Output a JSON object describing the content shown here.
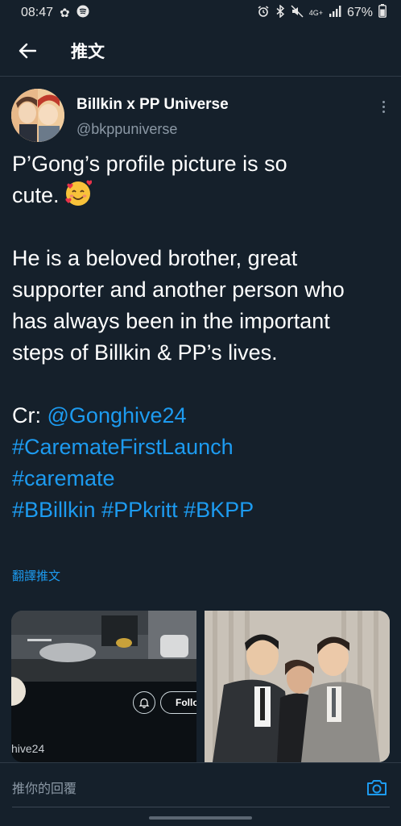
{
  "status_bar": {
    "time": "08:47",
    "network": "4G+",
    "battery": "67%"
  },
  "header": {
    "title": "推文"
  },
  "author": {
    "name": "Billkin x PP Universe",
    "handle": "@bkppuniverse"
  },
  "tweet": {
    "line1": "P’Gong’s profile picture is so",
    "line2": "cute.",
    "paragraph2": "He is a beloved brother, great supporter and another person who has always been in the important steps of Billkin & PP’s lives.",
    "credit_prefix": "Cr:",
    "credit_mention": "@Gonghive24",
    "hashtag1": "#CaremateFirstLaunch",
    "hashtag2": "#caremate",
    "hashtag3": "#BBillkin",
    "hashtag4": "#PPkritt",
    "hashtag5": "#BKPP"
  },
  "translate_label": "翻譯推文",
  "media": {
    "left_handle_fragment": "hive24",
    "follow_label": "Follo"
  },
  "reply": {
    "placeholder": "推你的回覆"
  },
  "colors": {
    "background": "#15202b",
    "link": "#1d9bf0",
    "muted": "#8b98a5"
  },
  "icons": [
    "back-arrow-icon",
    "more-vertical-icon",
    "smiling-face-with-hearts-emoji",
    "camera-icon",
    "notification-bell-icon"
  ]
}
